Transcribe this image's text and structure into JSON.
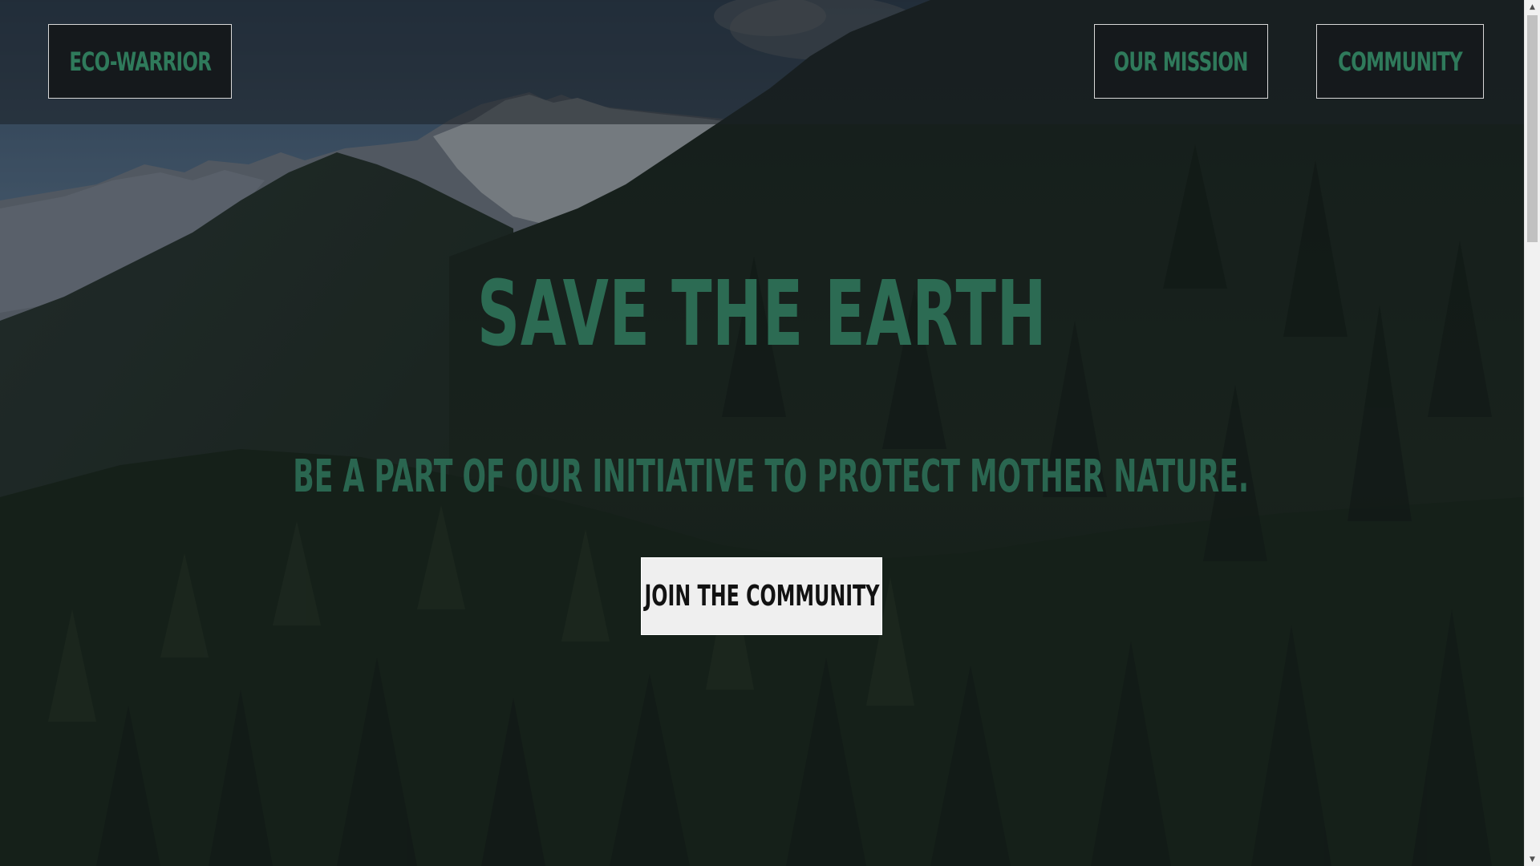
{
  "header": {
    "logo_label": "ECO-WARRIOR",
    "nav": {
      "mission_label": "OUR MISSION",
      "community_label": "COMMUNITY"
    }
  },
  "hero": {
    "title": "SAVE THE EARTH",
    "subtitle": "BE A PART OF OUR INITIATIVE TO PROTECT MOTHER NATURE.",
    "cta_label": "JOIN THE COMMUNITY"
  },
  "scrollbar": {
    "up_icon": "triangle-up",
    "down_icon": "triangle-down"
  },
  "colors": {
    "accent_green": "#2f7a5b",
    "header_box_bg": "#15191c",
    "cta_bg": "#efefef",
    "cta_text": "#121212"
  }
}
